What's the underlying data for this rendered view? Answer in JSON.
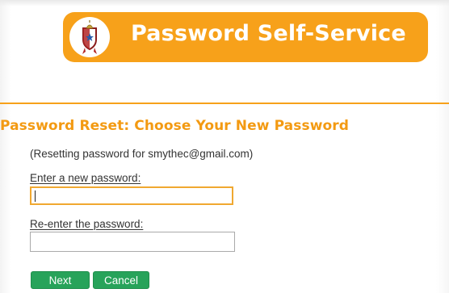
{
  "header": {
    "title": "Password Self-Service",
    "logo_icon": "crest-icon",
    "accent_color": "#f7a11a"
  },
  "main": {
    "heading_part1": "Password Reset:",
    "heading_part2": "Choose Your New Password",
    "info_text": "(Resetting password for smythec@gmail.com)",
    "new_password": {
      "label": "Enter a new password:",
      "value": ""
    },
    "reenter_password": {
      "label": "Re-enter the password:",
      "value": ""
    },
    "buttons": {
      "next_label": "Next",
      "cancel_label": "Cancel",
      "color": "#27a35a"
    }
  }
}
